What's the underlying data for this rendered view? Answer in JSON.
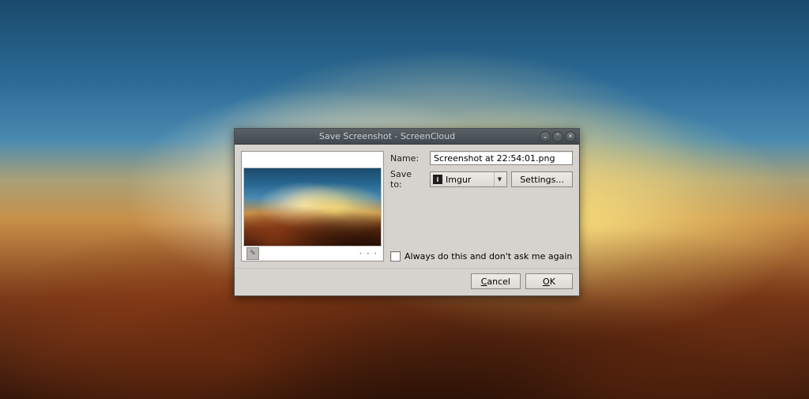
{
  "titlebar": {
    "title": "Save Screenshot - ScreenCloud",
    "minimize_icon": "⌄",
    "maximize_icon": "⌃",
    "close_icon": "✕"
  },
  "form": {
    "name_label": "Name:",
    "name_value": "Screenshot at 22:54:01.png",
    "saveto_label": "Save to:",
    "saveto_icon_letter": "i",
    "saveto_value": "Imgur",
    "saveto_arrow": "▼",
    "settings_label": "Settings..."
  },
  "checkbox": {
    "label": "Always do this and don't ask me again",
    "checked": false
  },
  "footer": {
    "cancel_label": "Cancel",
    "ok_label": "OK"
  },
  "preview": {
    "edit_glyph": "✎"
  }
}
